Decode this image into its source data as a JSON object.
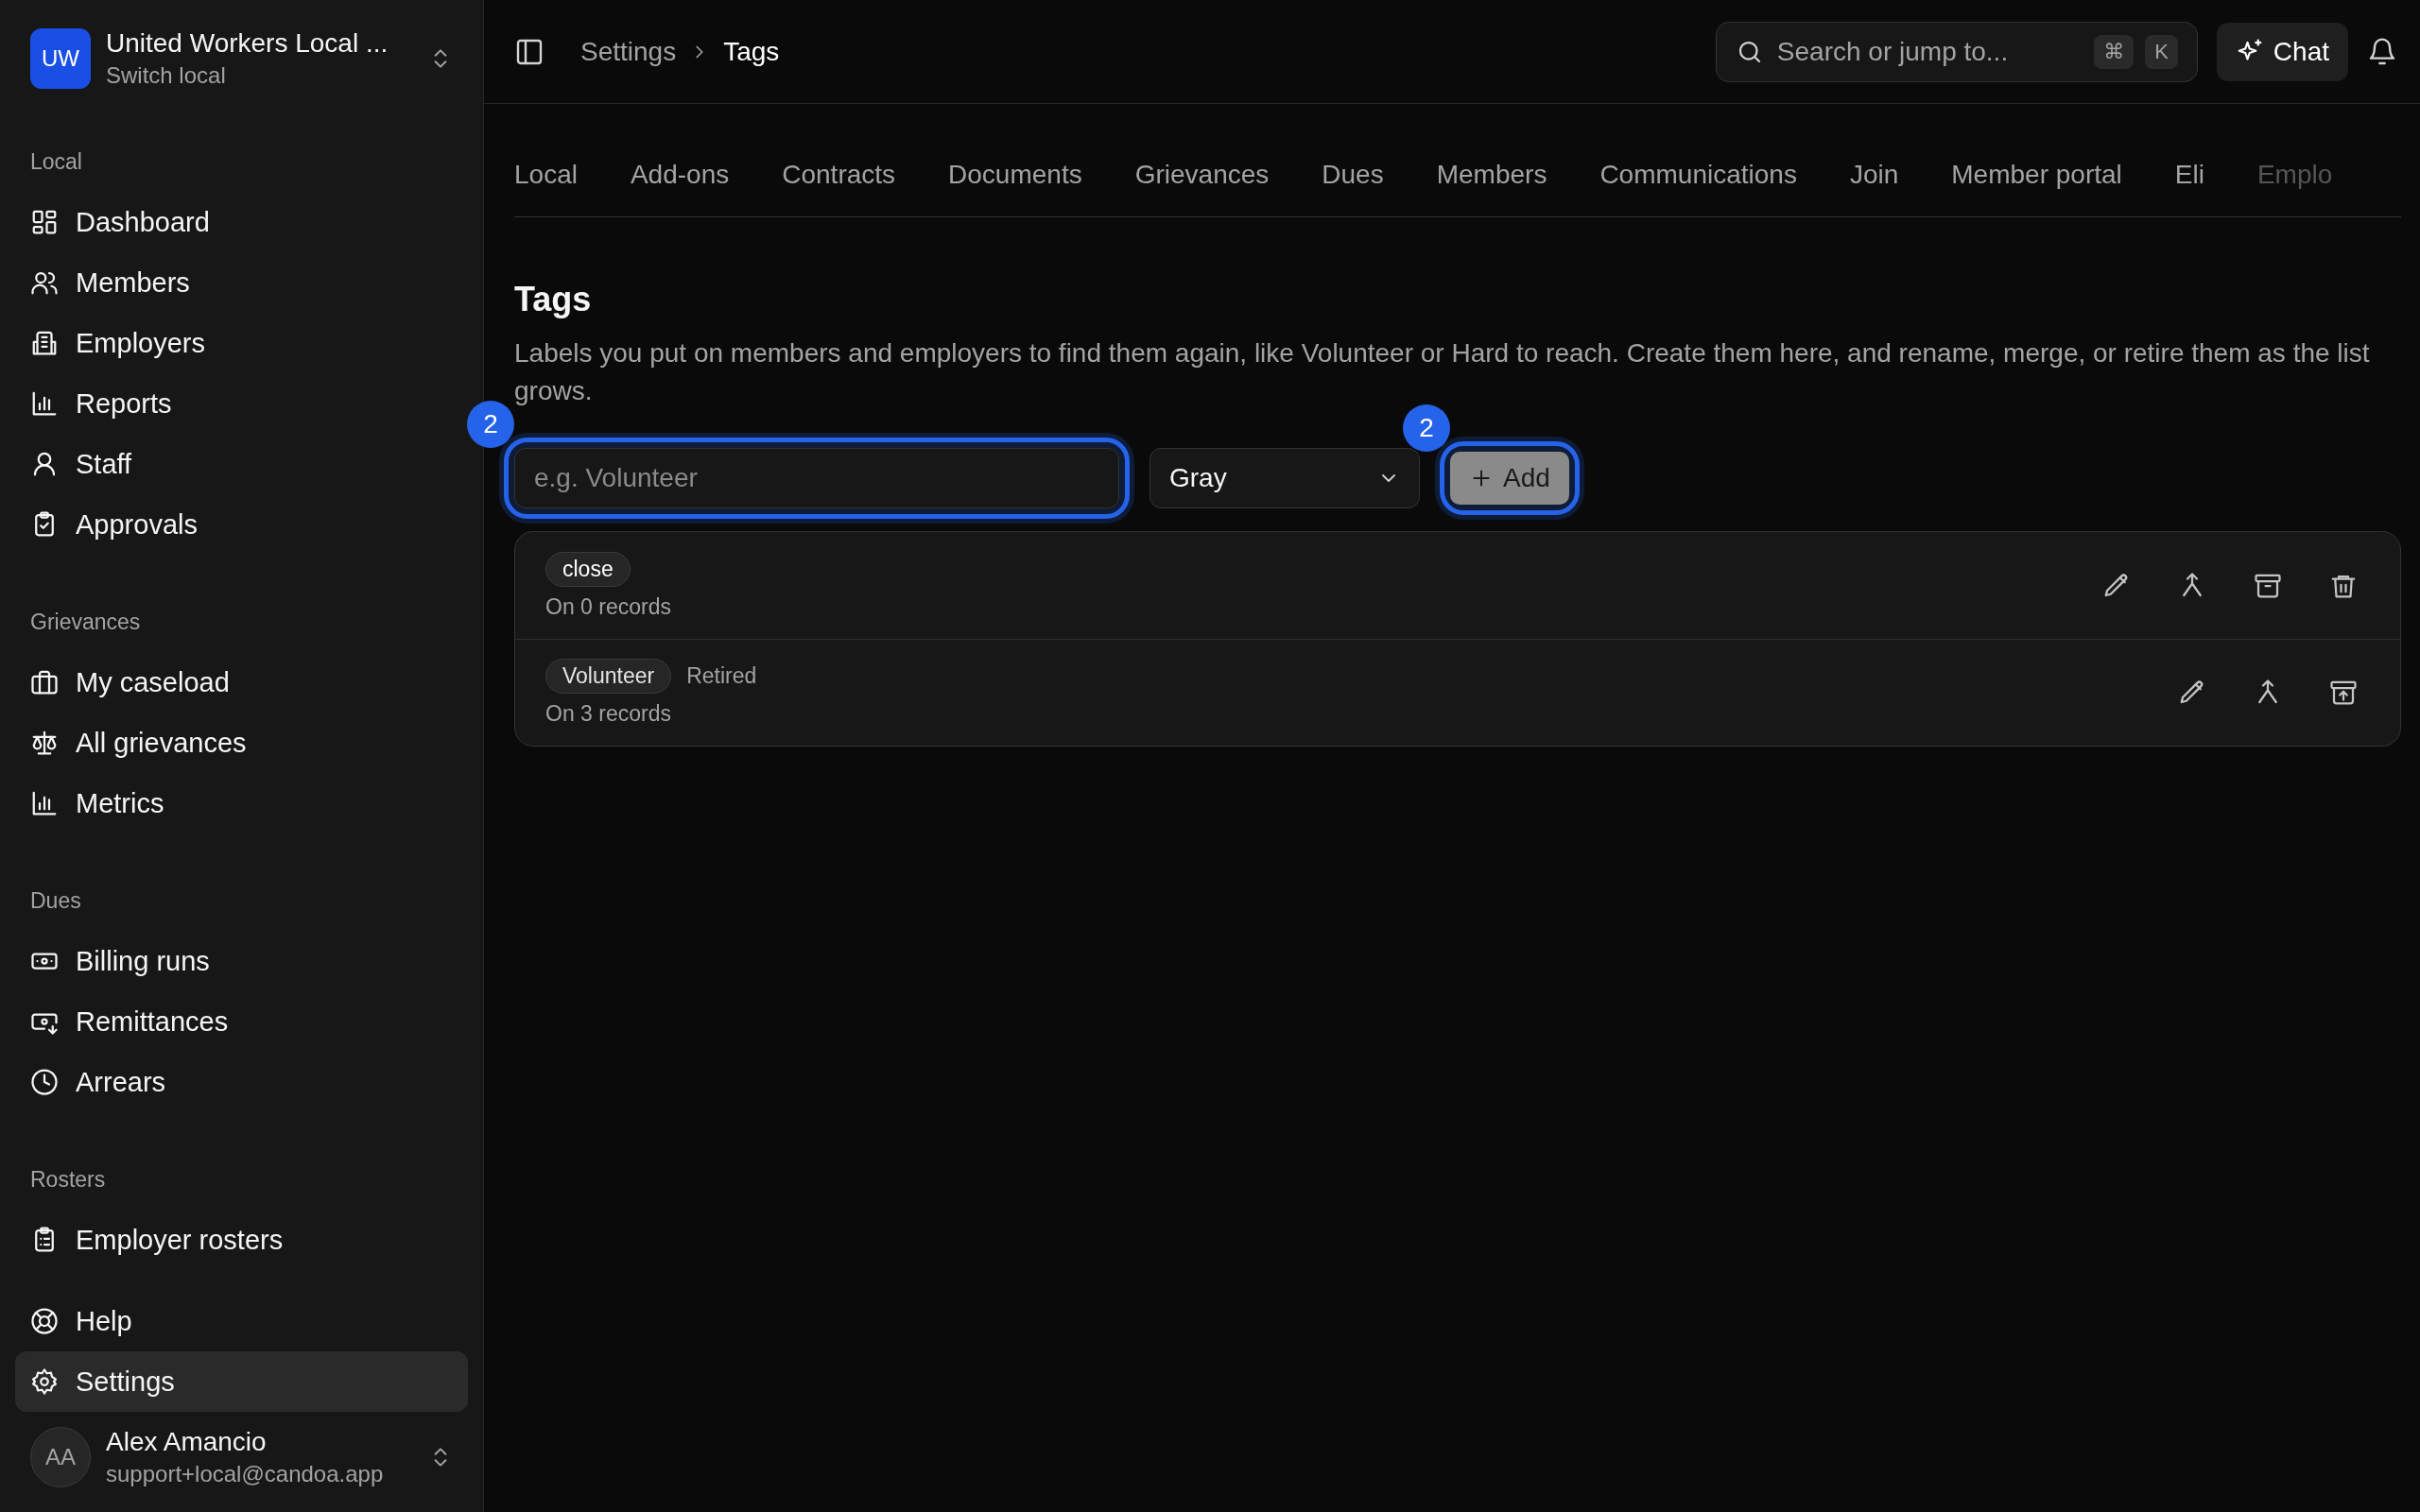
{
  "org": {
    "initials": "UW",
    "name": "United Workers Local ...",
    "subtitle": "Switch local"
  },
  "sidebar": {
    "sections": [
      {
        "label": "Local",
        "items": [
          {
            "label": "Dashboard",
            "selected": false
          },
          {
            "label": "Members",
            "selected": false
          },
          {
            "label": "Employers",
            "selected": false
          },
          {
            "label": "Reports",
            "selected": false
          },
          {
            "label": "Staff",
            "selected": false
          },
          {
            "label": "Approvals",
            "selected": false
          }
        ]
      },
      {
        "label": "Grievances",
        "items": [
          {
            "label": "My caseload",
            "selected": false
          },
          {
            "label": "All grievances",
            "selected": false
          },
          {
            "label": "Metrics",
            "selected": false
          }
        ]
      },
      {
        "label": "Dues",
        "items": [
          {
            "label": "Billing runs",
            "selected": false
          },
          {
            "label": "Remittances",
            "selected": false
          },
          {
            "label": "Arrears",
            "selected": false
          }
        ]
      },
      {
        "label": "Rosters",
        "items": [
          {
            "label": "Employer rosters",
            "selected": false
          }
        ]
      }
    ],
    "footer_items": [
      {
        "label": "Help",
        "selected": false
      },
      {
        "label": "Settings",
        "selected": true
      }
    ]
  },
  "user": {
    "initials": "AA",
    "name": "Alex Amancio",
    "email": "support+local@candoa.app"
  },
  "breadcrumb": [
    "Settings",
    "Tags"
  ],
  "search": {
    "placeholder": "Search or jump to...",
    "keys": [
      "⌘",
      "K"
    ]
  },
  "chat_button": "Chat",
  "tabs": [
    "Local",
    "Add-ons",
    "Contracts",
    "Documents",
    "Grievances",
    "Dues",
    "Members",
    "Communications",
    "Join",
    "Member portal",
    "Eli",
    "Emplo"
  ],
  "page": {
    "title": "Tags",
    "description": "Labels you put on members and employers to find them again, like Volunteer or Hard to reach. Create them here, and rename, merge, or retire them as the list grows."
  },
  "form": {
    "name_placeholder": "e.g. Volunteer",
    "name_badge": "2",
    "color_choice": "Gray",
    "add_label": "Add",
    "add_badge": "2"
  },
  "tags": [
    {
      "name": "close",
      "retired": false,
      "records": "On 0 records",
      "actions": [
        {
          "kind": "edit"
        },
        {
          "kind": "merge"
        },
        {
          "kind": "archive"
        },
        {
          "kind": "delete"
        }
      ]
    },
    {
      "name": "Volunteer",
      "retired": true,
      "status": "Retired",
      "records": "On 3 records",
      "actions": [
        {
          "kind": "edit"
        },
        {
          "kind": "merge"
        },
        {
          "kind": "unarchive"
        }
      ]
    }
  ]
}
